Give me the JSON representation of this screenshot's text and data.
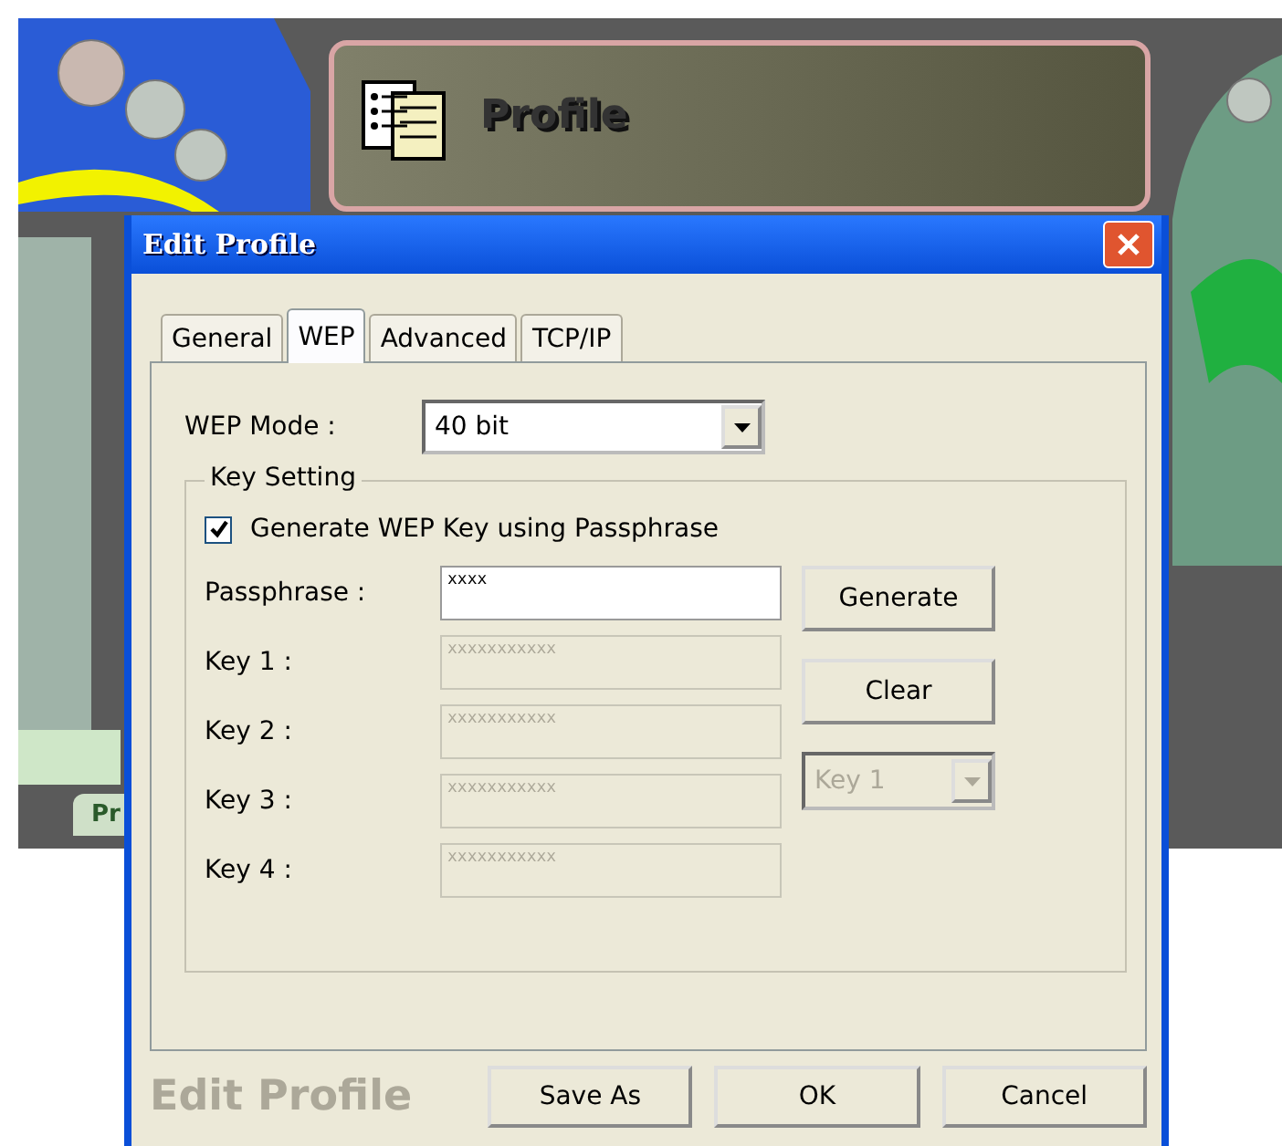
{
  "background_app": {
    "title": "Profile",
    "tab_label": "Pr"
  },
  "dialog": {
    "title": "Edit Profile"
  },
  "tabs": [
    {
      "label": "General",
      "selected": false
    },
    {
      "label": "WEP",
      "selected": true
    },
    {
      "label": "Advanced",
      "selected": false
    },
    {
      "label": "TCP/IP",
      "selected": false
    }
  ],
  "wep_mode": {
    "label": "WEP Mode :",
    "value": "40 bit"
  },
  "key_setting": {
    "title": "Key Setting",
    "generate_checkbox": {
      "label": "Generate WEP Key using Passphrase",
      "checked": true
    },
    "passphrase": {
      "label": "Passphrase :",
      "value": "xxxx",
      "disabled": false
    },
    "keys": [
      {
        "label": "Key 1 :",
        "value": "xxxxxxxxxxx",
        "disabled": true
      },
      {
        "label": "Key 2 :",
        "value": "xxxxxxxxxxx",
        "disabled": true
      },
      {
        "label": "Key 3 :",
        "value": "xxxxxxxxxxx",
        "disabled": true
      },
      {
        "label": "Key 4 :",
        "value": "xxxxxxxxxxx",
        "disabled": true
      }
    ],
    "buttons": [
      "Generate",
      "Clear"
    ],
    "default_key": {
      "value": "Key 1",
      "disabled": true
    }
  },
  "footer": {
    "brand": "Edit Profile",
    "buttons": [
      "Save As",
      "OK",
      "Cancel"
    ]
  }
}
